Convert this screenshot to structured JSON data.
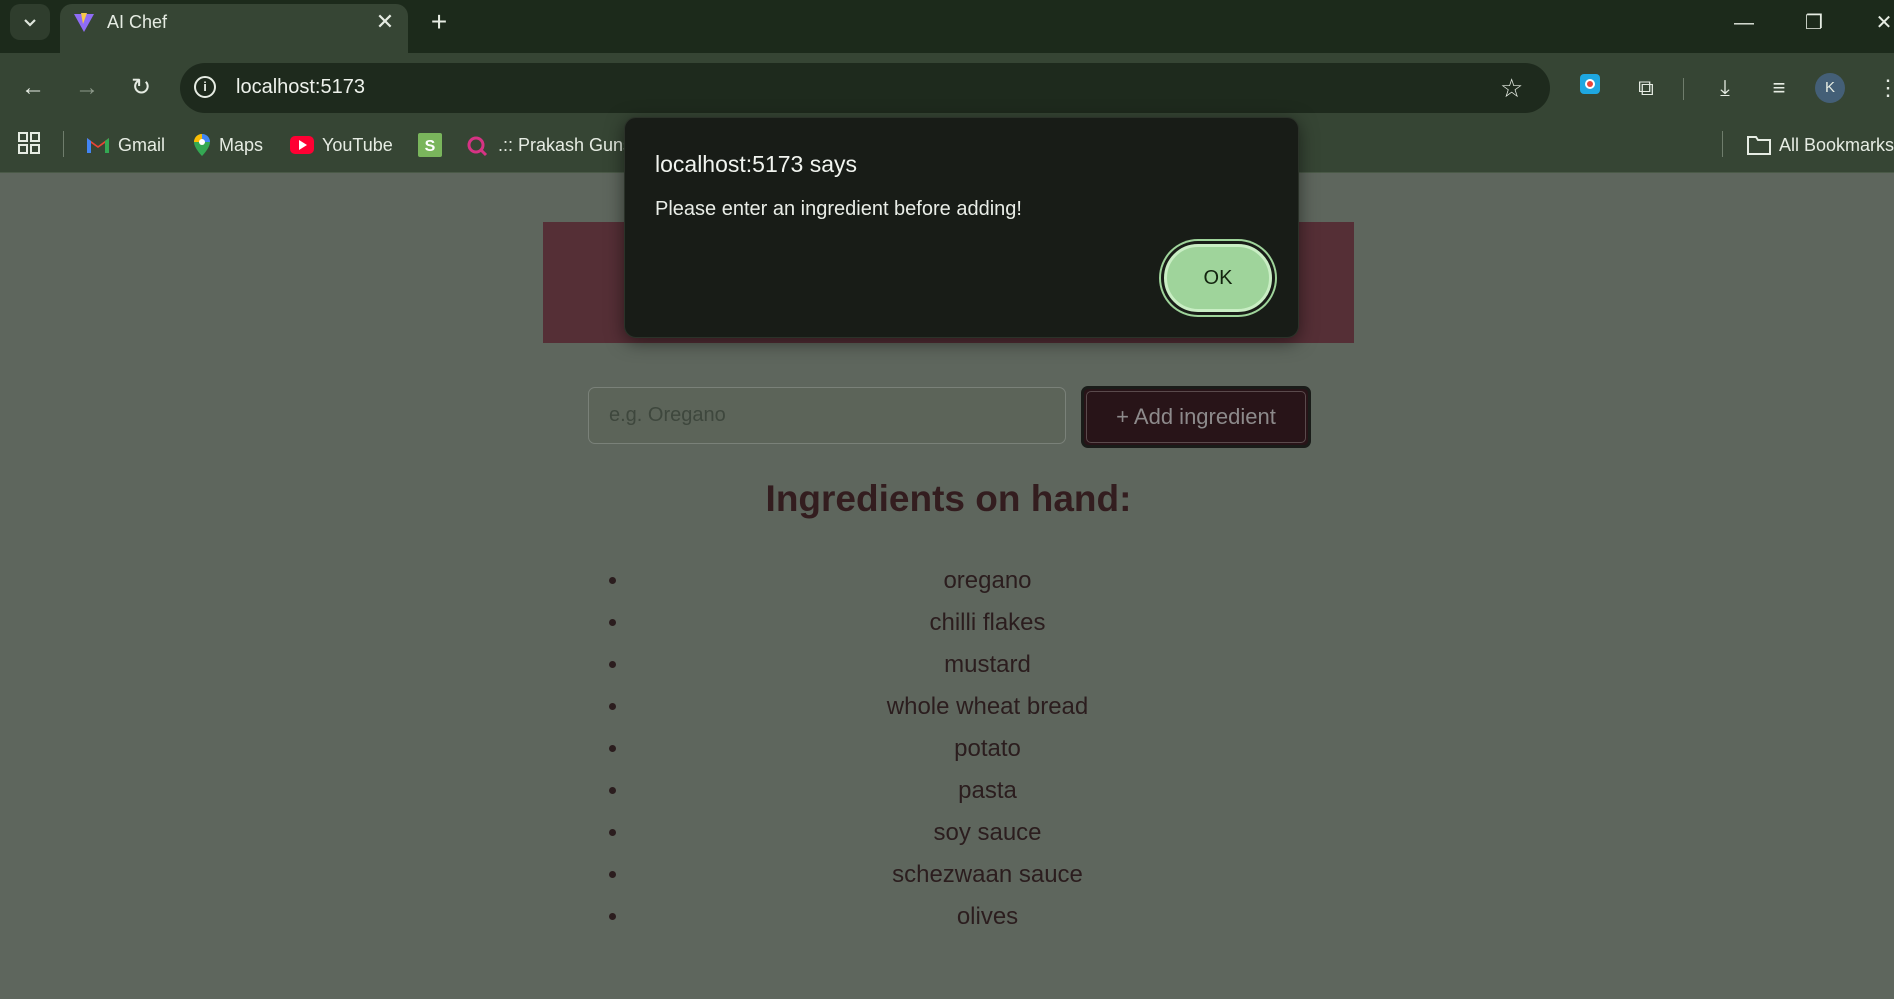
{
  "browser": {
    "tab": {
      "title": "AI Chef",
      "close_glyph": "✕"
    },
    "new_tab_glyph": "+",
    "url": "localhost:5173",
    "bookmarks": [
      {
        "label": "Gmail",
        "icon": "gmail-icon"
      },
      {
        "label": "Maps",
        "icon": "maps-icon"
      },
      {
        "label": "YouTube",
        "icon": "youtube-icon"
      },
      {
        "label": "",
        "icon": "shopify-icon"
      },
      {
        "label": ".:: Prakash Guns",
        "icon": "site-icon"
      }
    ],
    "all_bookmarks_label": "All Bookmarks",
    "profile_initial": "K"
  },
  "dialog": {
    "title": "localhost:5173 says",
    "message": "Please enter an ingredient before adding!",
    "ok_label": "OK"
  },
  "form": {
    "placeholder": "e.g. Oregano",
    "add_button_label": "+ Add ingredient"
  },
  "ingredients": {
    "heading": "Ingredients on hand:",
    "items": [
      "oregano",
      "chilli flakes",
      "mustard",
      "whole wheat bread",
      "potato",
      "pasta",
      "soy sauce",
      "schezwaan sauce",
      "olives"
    ]
  },
  "colors": {
    "accent_banner": "#552f36",
    "dialog_ok": "#9fd49b",
    "browser_chrome": "#364534"
  }
}
